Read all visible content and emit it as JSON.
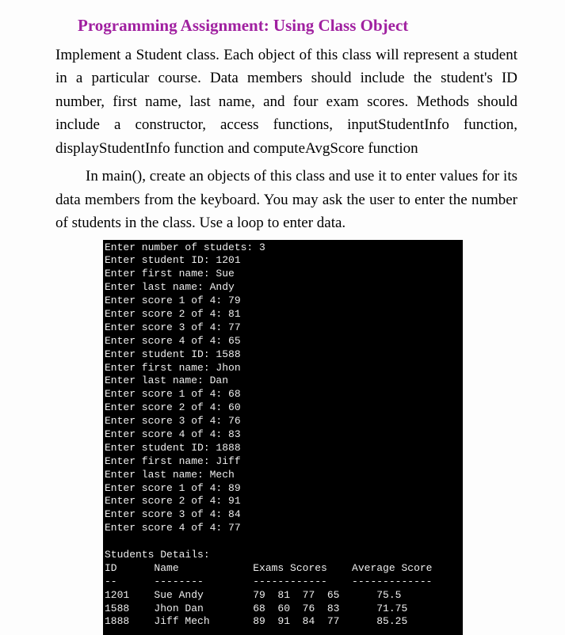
{
  "title": "Programming Assignment: Using Class Object",
  "paragraph1": "Implement a Student class.  Each object of this class will represent a student in a particular course.  Data members should include the student's ID number, first name, last name, and four exam scores.  Methods should include a constructor, access functions, inputStudentInfo function, displayStudentInfo function and computeAvgScore function",
  "paragraph2": "In main(), create an objects of this class and use it to enter values for its data members from the keyboard.  You may ask the user to enter the number of students in the class.  Use a loop to enter data.",
  "console_output": "Enter number of studets: 3\nEnter student ID: 1201\nEnter first name: Sue\nEnter last name: Andy\nEnter score 1 of 4: 79\nEnter score 2 of 4: 81\nEnter score 3 of 4: 77\nEnter score 4 of 4: 65\nEnter student ID: 1588\nEnter first name: Jhon\nEnter last name: Dan\nEnter score 1 of 4: 68\nEnter score 2 of 4: 60\nEnter score 3 of 4: 76\nEnter score 4 of 4: 83\nEnter student ID: 1888\nEnter first name: Jiff\nEnter last name: Mech\nEnter score 1 of 4: 89\nEnter score 2 of 4: 91\nEnter score 3 of 4: 84\nEnter score 4 of 4: 77\n\nStudents Details:\nID      Name            Exams Scores    Average Score\n--      --------        ------------    -------------\n1201    Sue Andy        79  81  77  65      75.5\n1588    Jhon Dan        68  60  76  83      71.75\n1888    Jiff Mech       89  91  84  77      85.25"
}
